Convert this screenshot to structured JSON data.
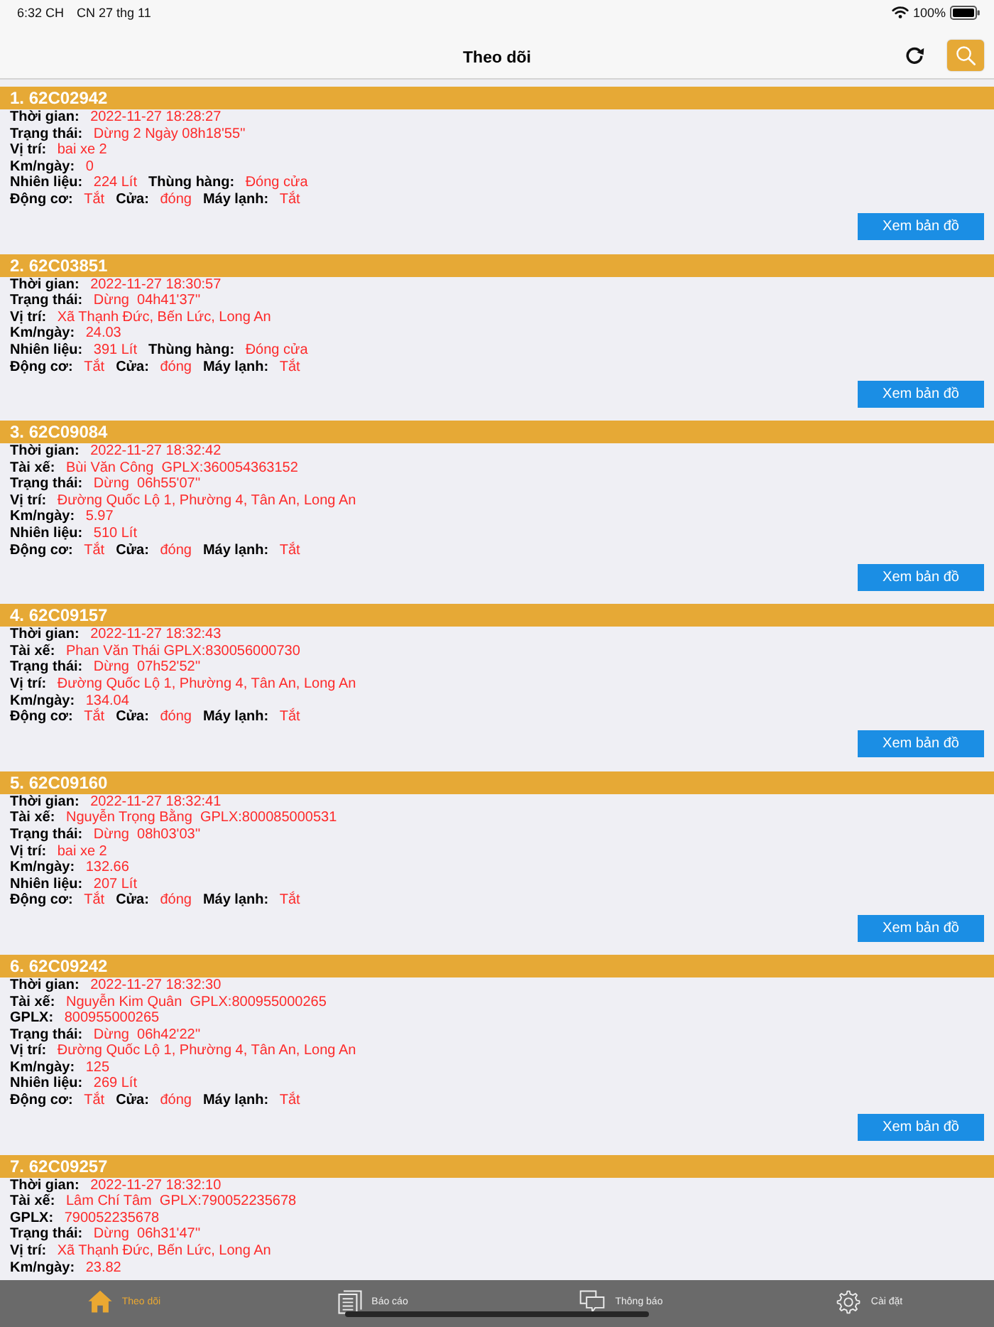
{
  "status_bar": {
    "time": "6:32 CH",
    "date": "CN 27 thg 11",
    "battery": "100%"
  },
  "navigation": {
    "title": "Theo dõi"
  },
  "vehicles": [
    {
      "title": "1. 62C02942",
      "rows": [
        {
          "fields": [
            {
              "label": "Thời gian:",
              "value": "2022-11-27 18:28:27"
            }
          ]
        },
        {
          "fields": [
            {
              "label": "Trạng thái:",
              "value": "Dừng 2 Ngày 08h18'55''"
            }
          ]
        },
        {
          "fields": [
            {
              "label": "Vị trí:",
              "value": "bai xe 2"
            }
          ]
        },
        {
          "fields": [
            {
              "label": "Km/ngày:",
              "value": "0"
            }
          ]
        },
        {
          "fields": [
            {
              "label": "Nhiên liệu:",
              "value": "224 Lít"
            },
            {
              "label": "Thùng hàng:",
              "value": "Đóng cửa"
            }
          ]
        },
        {
          "fields": [
            {
              "label": "Động cơ:",
              "value": "Tắt"
            },
            {
              "label": "Cửa:",
              "value": "đóng"
            },
            {
              "label": "Máy lạnh:",
              "value": "Tắt"
            }
          ]
        }
      ],
      "button": "Xem bản đồ"
    },
    {
      "title": "2. 62C03851",
      "rows": [
        {
          "fields": [
            {
              "label": "Thời gian:",
              "value": "2022-11-27 18:30:57"
            }
          ]
        },
        {
          "fields": [
            {
              "label": "Trạng thái:",
              "value": "Dừng  04h41'37''"
            }
          ]
        },
        {
          "fields": [
            {
              "label": "Vị trí:",
              "value": "Xã Thạnh Đức, Bến Lức, Long An"
            }
          ]
        },
        {
          "fields": [
            {
              "label": "Km/ngày:",
              "value": "24.03"
            }
          ]
        },
        {
          "fields": [
            {
              "label": "Nhiên liệu:",
              "value": "391 Lít"
            },
            {
              "label": "Thùng hàng:",
              "value": "Đóng cửa"
            }
          ]
        },
        {
          "fields": [
            {
              "label": "Động cơ:",
              "value": "Tắt"
            },
            {
              "label": "Cửa:",
              "value": "đóng"
            },
            {
              "label": "Máy lạnh:",
              "value": "Tắt"
            }
          ]
        }
      ],
      "button": "Xem bản đồ"
    },
    {
      "title": "3. 62C09084",
      "rows": [
        {
          "fields": [
            {
              "label": "Thời gian:",
              "value": "2022-11-27 18:32:42"
            }
          ]
        },
        {
          "fields": [
            {
              "label": "Tài xế:",
              "value": "Bùi Văn Công  GPLX:360054363152"
            }
          ]
        },
        {
          "fields": [
            {
              "label": "Trạng thái:",
              "value": "Dừng  06h55'07''"
            }
          ]
        },
        {
          "fields": [
            {
              "label": "Vị trí:",
              "value": "Đường Quốc Lộ 1, Phường 4, Tân An, Long An"
            }
          ]
        },
        {
          "fields": [
            {
              "label": "Km/ngày:",
              "value": "5.97"
            }
          ]
        },
        {
          "fields": [
            {
              "label": "Nhiên liệu:",
              "value": "510 Lít"
            }
          ]
        },
        {
          "fields": [
            {
              "label": "Động cơ:",
              "value": "Tắt"
            },
            {
              "label": "Cửa:",
              "value": "đóng"
            },
            {
              "label": "Máy lạnh:",
              "value": "Tắt"
            }
          ]
        }
      ],
      "button": "Xem bản đồ"
    },
    {
      "title": "4. 62C09157",
      "rows": [
        {
          "fields": [
            {
              "label": "Thời gian:",
              "value": "2022-11-27 18:32:43"
            }
          ]
        },
        {
          "fields": [
            {
              "label": "Tài xế:",
              "value": "Phan Văn Thái GPLX:830056000730"
            }
          ]
        },
        {
          "fields": [
            {
              "label": "Trạng thái:",
              "value": "Dừng  07h52'52''"
            }
          ]
        },
        {
          "fields": [
            {
              "label": "Vị trí:",
              "value": "Đường Quốc Lộ 1, Phường 4, Tân An, Long An"
            }
          ]
        },
        {
          "fields": [
            {
              "label": "Km/ngày:",
              "value": "134.04"
            }
          ]
        },
        {
          "fields": [
            {
              "label": "Động cơ:",
              "value": "Tắt"
            },
            {
              "label": "Cửa:",
              "value": "đóng"
            },
            {
              "label": "Máy lạnh:",
              "value": "Tắt"
            }
          ]
        }
      ],
      "button": "Xem bản đồ"
    },
    {
      "title": "5. 62C09160",
      "rows": [
        {
          "fields": [
            {
              "label": "Thời gian:",
              "value": "2022-11-27 18:32:41"
            }
          ]
        },
        {
          "fields": [
            {
              "label": "Tài xế:",
              "value": "Nguyễn Trọng Bằng  GPLX:800085000531"
            }
          ]
        },
        {
          "fields": [
            {
              "label": "Trạng thái:",
              "value": "Dừng  08h03'03''"
            }
          ]
        },
        {
          "fields": [
            {
              "label": "Vị trí:",
              "value": "bai xe 2"
            }
          ]
        },
        {
          "fields": [
            {
              "label": "Km/ngày:",
              "value": "132.66"
            }
          ]
        },
        {
          "fields": [
            {
              "label": "Nhiên liệu:",
              "value": "207 Lít"
            }
          ]
        },
        {
          "fields": [
            {
              "label": "Động cơ:",
              "value": "Tắt"
            },
            {
              "label": "Cửa:",
              "value": "đóng"
            },
            {
              "label": "Máy lạnh:",
              "value": "Tắt"
            }
          ]
        }
      ],
      "button": "Xem bản đồ"
    },
    {
      "title": "6. 62C09242",
      "rows": [
        {
          "fields": [
            {
              "label": "Thời gian:",
              "value": "2022-11-27 18:32:30"
            }
          ]
        },
        {
          "fields": [
            {
              "label": "Tài xế:",
              "value": "Nguyễn Kim Quân  GPLX:800955000265"
            }
          ]
        },
        {
          "fields": [
            {
              "label": "GPLX:",
              "value": "800955000265"
            }
          ]
        },
        {
          "fields": [
            {
              "label": "Trạng thái:",
              "value": "Dừng  06h42'22''"
            }
          ]
        },
        {
          "fields": [
            {
              "label": "Vị trí:",
              "value": "Đường Quốc Lộ 1, Phường 4, Tân An, Long An"
            }
          ]
        },
        {
          "fields": [
            {
              "label": "Km/ngày:",
              "value": "125"
            }
          ]
        },
        {
          "fields": [
            {
              "label": "Nhiên liệu:",
              "value": "269 Lít"
            }
          ]
        },
        {
          "fields": [
            {
              "label": "Động cơ:",
              "value": "Tắt"
            },
            {
              "label": "Cửa:",
              "value": "đóng"
            },
            {
              "label": "Máy lạnh:",
              "value": "Tắt"
            }
          ]
        }
      ],
      "button": "Xem bản đồ"
    },
    {
      "title": "7. 62C09257",
      "rows": [
        {
          "fields": [
            {
              "label": "Thời gian:",
              "value": "2022-11-27 18:32:10"
            }
          ]
        },
        {
          "fields": [
            {
              "label": "Tài xế:",
              "value": "Lâm Chí Tâm  GPLX:790052235678"
            }
          ]
        },
        {
          "fields": [
            {
              "label": "GPLX:",
              "value": "790052235678"
            }
          ]
        },
        {
          "fields": [
            {
              "label": "Trạng thái:",
              "value": "Dừng  06h31'47''"
            }
          ]
        },
        {
          "fields": [
            {
              "label": "Vị trí:",
              "value": "Xã Thạnh Đức, Bến Lức, Long An"
            }
          ]
        },
        {
          "fields": [
            {
              "label": "Km/ngày:",
              "value": "23.82"
            }
          ]
        }
      ]
    }
  ],
  "tab_bar": [
    {
      "label": "Theo dõi",
      "selected": true
    },
    {
      "label": "Báo cáo",
      "selected": false
    },
    {
      "label": "Thông báo",
      "selected": false
    },
    {
      "label": "Cài đặt",
      "selected": false
    }
  ]
}
